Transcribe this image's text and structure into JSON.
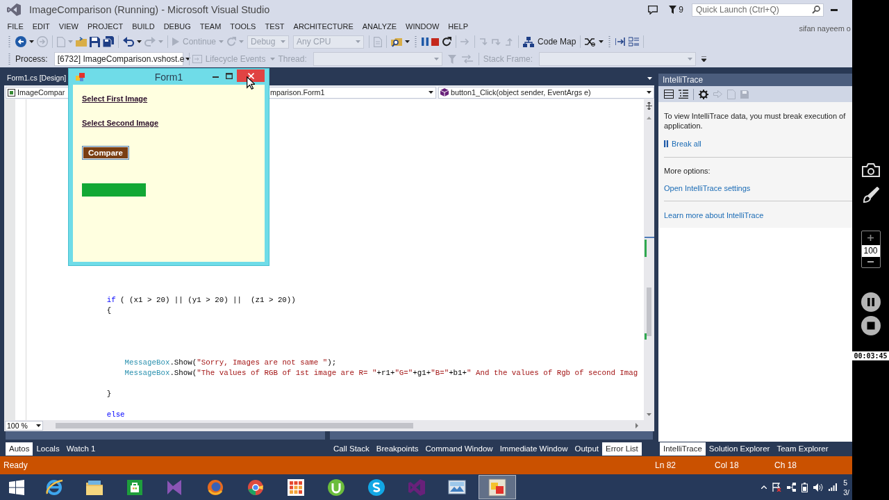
{
  "window": {
    "title": "ImageComparison (Running) - Microsoft Visual Studio"
  },
  "title_bar": {
    "notifications": "9",
    "quick_launch": {
      "placeholder": "Quick Launch (Ctrl+Q)"
    }
  },
  "menu": [
    "FILE",
    "EDIT",
    "VIEW",
    "PROJECT",
    "BUILD",
    "DEBUG",
    "TEAM",
    "TOOLS",
    "TEST",
    "ARCHITECTURE",
    "ANALYZE",
    "WINDOW",
    "HELP"
  ],
  "user": "sifan nayeem o",
  "toolbar": {
    "continue": {
      "label": "Continue",
      "disabled": true
    },
    "configuration": {
      "value": "Debug",
      "disabled": true
    },
    "platform": {
      "value": "Any CPU",
      "disabled": true
    },
    "code_map": {
      "label": "Code Map",
      "disabled": false
    }
  },
  "debug_location": {
    "process": {
      "label": "Process:",
      "value": "[6732] ImageComparison.vshost.e"
    },
    "lifecycle_events": {
      "label": "Lifecycle Events",
      "disabled": true
    },
    "thread": {
      "label": "Thread:",
      "disabled": true
    },
    "stack_frame": {
      "label": "Stack Frame:",
      "disabled": true
    }
  },
  "document_tabs": [
    {
      "label": "Form1.cs [Design]",
      "selected": false
    }
  ],
  "editor": {
    "navigation": [
      "ImageCompar",
      "mparison.Form1",
      "button1_Click(object sender, EventArgs e)"
    ],
    "code": [
      {
        "kind": "code",
        "segments": [
          {
            "kind": "keyword",
            "text": "                if"
          },
          {
            "kind": "plain",
            "text": " ( (x1 > 20) || (y1 > 20) ||  (z1 > 20))"
          }
        ]
      },
      {
        "kind": "code",
        "segments": [
          {
            "kind": "plain",
            "text": "                {"
          }
        ]
      },
      {
        "kind": "blank"
      },
      {
        "kind": "blank"
      },
      {
        "kind": "blank"
      },
      {
        "kind": "blank"
      },
      {
        "kind": "code",
        "segments": [
          {
            "kind": "type",
            "text": "                    MessageBox"
          },
          {
            "kind": "plain",
            "text": ".Show("
          },
          {
            "kind": "string",
            "text": "\"Sorry, Images are not same \""
          },
          {
            "kind": "plain",
            "text": ");"
          }
        ]
      },
      {
        "kind": "code",
        "segments": [
          {
            "kind": "type",
            "text": "                    MessageBox"
          },
          {
            "kind": "plain",
            "text": ".Show("
          },
          {
            "kind": "string",
            "text": "\"The values of RGB of 1st image are R= \""
          },
          {
            "kind": "plain",
            "text": "+r1+"
          },
          {
            "kind": "string",
            "text": "\"G=\""
          },
          {
            "kind": "plain",
            "text": "+g1+"
          },
          {
            "kind": "string",
            "text": "\"B=\""
          },
          {
            "kind": "plain",
            "text": "+b1+"
          },
          {
            "kind": "string",
            "text": "\" And the values of Rgb of second Imag"
          }
        ]
      },
      {
        "kind": "blank"
      },
      {
        "kind": "code",
        "segments": [
          {
            "kind": "plain",
            "text": "                }"
          }
        ]
      },
      {
        "kind": "blank"
      },
      {
        "kind": "code",
        "segments": [
          {
            "kind": "keyword",
            "text": "                else"
          }
        ]
      }
    ],
    "zoom": "100 %"
  },
  "form_window": {
    "title": "Form1",
    "links": [
      "Select First Image",
      "Select Second Image"
    ],
    "button": "Compare"
  },
  "intellitrace": {
    "title": "IntelliTrace",
    "message": "To view IntelliTrace data, you must break execution of\napplication.",
    "break_all": "Break all",
    "more_options": "More options:",
    "settings_link": "Open IntelliTrace settings",
    "learn_more_link": "Learn more about IntelliTrace"
  },
  "bottom_tabs": {
    "left": [
      {
        "label": "Autos",
        "selected": true
      },
      {
        "label": "Locals",
        "selected": false
      },
      {
        "label": "Watch 1",
        "selected": false
      }
    ],
    "center": [
      {
        "label": "Call Stack",
        "selected": false
      },
      {
        "label": "Breakpoints",
        "selected": false
      },
      {
        "label": "Command Window",
        "selected": false
      },
      {
        "label": "Immediate Window",
        "selected": false
      },
      {
        "label": "Output",
        "selected": false
      },
      {
        "label": "Error List",
        "selected": true
      }
    ],
    "right": [
      {
        "label": "IntelliTrace",
        "selected": true
      },
      {
        "label": "Solution Explorer",
        "selected": false
      },
      {
        "label": "Team Explorer",
        "selected": false
      }
    ]
  },
  "status_bar": {
    "status": "Ready",
    "line": "Ln 82",
    "column": "Col 18",
    "character": "Ch 18"
  },
  "taskbar": {
    "apps": [
      {
        "selected": false
      },
      {
        "selected": false
      },
      {
        "selected": false
      },
      {
        "selected": false
      },
      {
        "selected": false
      },
      {
        "selected": false
      },
      {
        "selected": false
      },
      {
        "selected": false
      },
      {
        "selected": false
      },
      {
        "selected": false
      },
      {
        "selected": false
      },
      {
        "selected": true
      }
    ],
    "clock": {
      "time": "5",
      "date": "3/"
    }
  },
  "recorder": {
    "zoom": "100",
    "timer": "00:03:45"
  }
}
